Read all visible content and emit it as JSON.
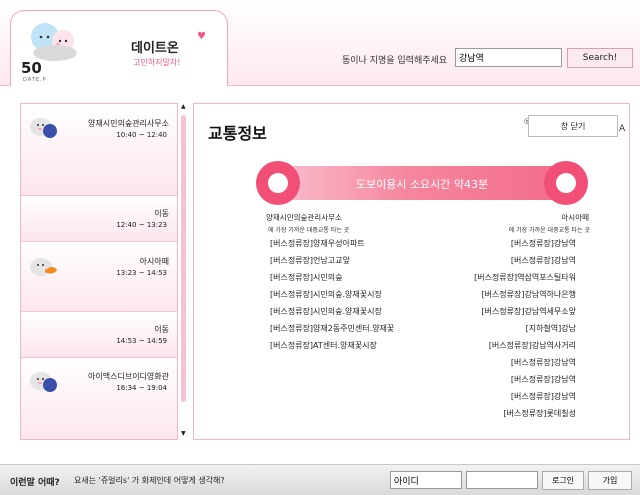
{
  "header": {
    "logo_number": "50",
    "logo_sub": "DATE.P",
    "brand": "데이트온",
    "brand_sub": "고민하지말자!",
    "search_label": "동이나 지명을 입력해주세요",
    "search_value": "강남역",
    "search_button": "Search!"
  },
  "schedule": [
    {
      "name": "양재시민의숲관리사무소",
      "time": "10:40 ~ 12:40",
      "icon": "cloud-blue-icon"
    },
    {
      "name": "이동",
      "time": "12:40 ~ 13:23"
    },
    {
      "name": "아시아떼",
      "time": "13:23 ~ 14:53",
      "icon": "cloud-orange-icon"
    },
    {
      "name": "이동",
      "time": "14:53 ~ 14:59"
    },
    {
      "name": "아이맥스디브이디영화관",
      "time": "16:34 ~ 19:04",
      "icon": "cloud-blue-icon"
    }
  ],
  "main": {
    "title": "교통정보",
    "close_button": "창 닫기",
    "close_a": "A",
    "banner_text": "도보이용시 소요시간 약43분",
    "from": {
      "name": "양재시민의숲관리사무소",
      "note": "에 가장 가까운 대중교통 타는 곳",
      "stops": [
        "[버스정류장]양재우성아파트",
        "[버스정류장]언남고교앞",
        "[버스정류장]시민의숲",
        "[버스정류장]시민의숲.양재꽃시장",
        "[버스정류장]시민의숲.양재꽃시장",
        "[버스정류장]양재2동주민센터.양재꽃",
        "[버스정류장]AT센터.양재꽃시장"
      ]
    },
    "to": {
      "name": "아시아떼",
      "note": "에 가장 가까운 대중교통 타는 곳",
      "stops": [
        "[버스정류장]강남역",
        "[버스정류장]강남역",
        "[버스정류장]역삼역포스틸타워",
        "[버스정류장]강남역하나은행",
        "[버스정류장]강남역세무소앞",
        "[지하철역]강남",
        "[버스정류장]강남역사거리",
        "[버스정류장]강남역",
        "[버스정류장]강남역",
        "[버스정류장]강남역",
        "[버스정류장]롯데칠성"
      ]
    }
  },
  "footer": {
    "question": "이런말 어때?",
    "message": "요새는 '쥬얼리s' 가 화제인데 어떻게 생각해?",
    "id_placeholder": "아이디",
    "login_button": "로그인",
    "join_button": "가입"
  },
  "colors": {
    "accent": "#f14f76",
    "pink_light": "#fce6ec"
  }
}
